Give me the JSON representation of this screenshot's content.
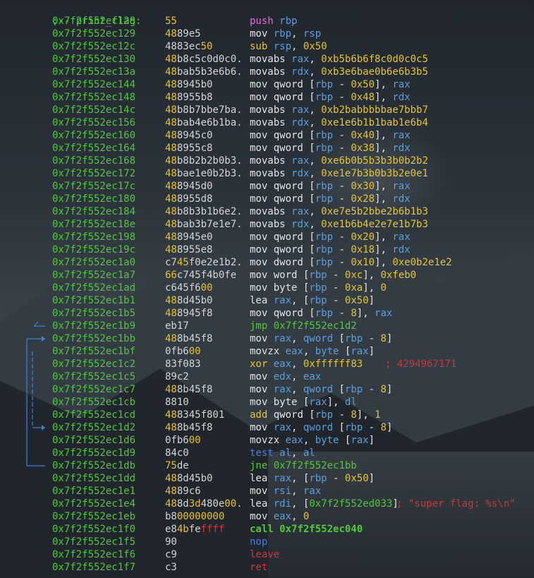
{
  "header_label": ";-- print_flag:",
  "colors": {
    "address": "#4fc93a",
    "register": "#5a9fe0",
    "immediate": "#e4c534",
    "comment": "#c33a3a",
    "jump_arrows": "#3b7fe0"
  },
  "rows": [
    {
      "addr": "0x7f2f552ec128",
      "bytes": [
        [
          "55",
          "hl"
        ]
      ],
      "ins": [
        [
          "push",
          "mn-push"
        ],
        [
          " "
        ],
        [
          "rbp",
          "reg"
        ]
      ]
    },
    {
      "addr": "0x7f2f552ec129",
      "bytes": [
        [
          "48",
          "hl"
        ],
        [
          "89e5"
        ]
      ],
      "ins": [
        [
          "mov "
        ],
        [
          "rbp",
          "reg"
        ],
        [
          ", "
        ],
        [
          "rsp",
          "reg"
        ]
      ]
    },
    {
      "addr": "0x7f2f552ec12c",
      "bytes": [
        [
          "4883ec"
        ],
        [
          "50",
          "hl"
        ]
      ],
      "ins": [
        [
          "sub",
          "mn-sub"
        ],
        [
          " "
        ],
        [
          "rsp",
          "reg"
        ],
        [
          ", "
        ],
        [
          "0x50",
          "num"
        ]
      ]
    },
    {
      "addr": "0x7f2f552ec130",
      "bytes": [
        [
          "48",
          "hl"
        ],
        [
          "b8c5c0d0c0."
        ]
      ],
      "ins": [
        [
          "movabs "
        ],
        [
          "rax",
          "reg"
        ],
        [
          ", "
        ],
        [
          "0xb5b6b6f8c0d0c0c5",
          "num"
        ]
      ]
    },
    {
      "addr": "0x7f2f552ec13a",
      "bytes": [
        [
          "48",
          "hl"
        ],
        [
          "bab5b3e6b6."
        ]
      ],
      "ins": [
        [
          "movabs "
        ],
        [
          "rdx",
          "reg"
        ],
        [
          ", "
        ],
        [
          "0xb3e6bae0b6e6b3b5",
          "num"
        ]
      ]
    },
    {
      "addr": "0x7f2f552ec144",
      "bytes": [
        [
          "48",
          "hl"
        ],
        [
          "8945b0"
        ]
      ],
      "ins": [
        [
          "mov qword ["
        ],
        [
          "rbp",
          "reg"
        ],
        [
          " - "
        ],
        [
          "0x50",
          "num"
        ],
        [
          "], "
        ],
        [
          "rax",
          "reg"
        ]
      ]
    },
    {
      "addr": "0x7f2f552ec148",
      "bytes": [
        [
          "48",
          "hl"
        ],
        [
          "8955b8"
        ]
      ],
      "ins": [
        [
          "mov qword ["
        ],
        [
          "rbp",
          "reg"
        ],
        [
          " - "
        ],
        [
          "0x48",
          "num"
        ],
        [
          "], "
        ],
        [
          "rdx",
          "reg"
        ]
      ]
    },
    {
      "addr": "0x7f2f552ec14c",
      "bytes": [
        [
          "48",
          "hl"
        ],
        [
          "b8b7bbe7ba."
        ]
      ],
      "ins": [
        [
          "movabs "
        ],
        [
          "rax",
          "reg"
        ],
        [
          ", "
        ],
        [
          "0xb2babbbbbae7bbb7",
          "num"
        ]
      ]
    },
    {
      "addr": "0x7f2f552ec156",
      "bytes": [
        [
          "48",
          "hl"
        ],
        [
          "bab4e6b1ba."
        ]
      ],
      "ins": [
        [
          "movabs "
        ],
        [
          "rdx",
          "reg"
        ],
        [
          ", "
        ],
        [
          "0xe1e6b1b1bab1e6b4",
          "num"
        ]
      ]
    },
    {
      "addr": "0x7f2f552ec160",
      "bytes": [
        [
          "48",
          "hl"
        ],
        [
          "8945c0"
        ]
      ],
      "ins": [
        [
          "mov qword ["
        ],
        [
          "rbp",
          "reg"
        ],
        [
          " - "
        ],
        [
          "0x40",
          "num"
        ],
        [
          "], "
        ],
        [
          "rax",
          "reg"
        ]
      ]
    },
    {
      "addr": "0x7f2f552ec164",
      "bytes": [
        [
          "48",
          "hl"
        ],
        [
          "8955c8"
        ]
      ],
      "ins": [
        [
          "mov qword ["
        ],
        [
          "rbp",
          "reg"
        ],
        [
          " - "
        ],
        [
          "0x38",
          "num"
        ],
        [
          "], "
        ],
        [
          "rdx",
          "reg"
        ]
      ]
    },
    {
      "addr": "0x7f2f552ec168",
      "bytes": [
        [
          "48",
          "hl"
        ],
        [
          "b8b2b2b0b3."
        ]
      ],
      "ins": [
        [
          "movabs "
        ],
        [
          "rax",
          "reg"
        ],
        [
          ", "
        ],
        [
          "0xe6b0b5b3b3b0b2b2",
          "num"
        ]
      ]
    },
    {
      "addr": "0x7f2f552ec172",
      "bytes": [
        [
          "48",
          "hl"
        ],
        [
          "bae1e0b2b3."
        ]
      ],
      "ins": [
        [
          "movabs "
        ],
        [
          "rdx",
          "reg"
        ],
        [
          ", "
        ],
        [
          "0xe1e7b3b0b3b2e0e1",
          "num"
        ]
      ]
    },
    {
      "addr": "0x7f2f552ec17c",
      "bytes": [
        [
          "48",
          "hl"
        ],
        [
          "8945d0"
        ]
      ],
      "ins": [
        [
          "mov qword ["
        ],
        [
          "rbp",
          "reg"
        ],
        [
          " - "
        ],
        [
          "0x30",
          "num"
        ],
        [
          "], "
        ],
        [
          "rax",
          "reg"
        ]
      ]
    },
    {
      "addr": "0x7f2f552ec180",
      "bytes": [
        [
          "48",
          "hl"
        ],
        [
          "8955d8"
        ]
      ],
      "ins": [
        [
          "mov qword ["
        ],
        [
          "rbp",
          "reg"
        ],
        [
          " - "
        ],
        [
          "0x28",
          "num"
        ],
        [
          "], "
        ],
        [
          "rdx",
          "reg"
        ]
      ]
    },
    {
      "addr": "0x7f2f552ec184",
      "bytes": [
        [
          "48",
          "hl"
        ],
        [
          "b8b3b1b6e2."
        ]
      ],
      "ins": [
        [
          "movabs "
        ],
        [
          "rax",
          "reg"
        ],
        [
          ", "
        ],
        [
          "0xe7e5b2bbe2b6b1b3",
          "num"
        ]
      ]
    },
    {
      "addr": "0x7f2f552ec18e",
      "bytes": [
        [
          "48",
          "hl"
        ],
        [
          "bab3b7e1e7."
        ]
      ],
      "ins": [
        [
          "movabs "
        ],
        [
          "rdx",
          "reg"
        ],
        [
          ", "
        ],
        [
          "0xe1b6b4e2e7e1b7b3",
          "num"
        ]
      ]
    },
    {
      "addr": "0x7f2f552ec198",
      "bytes": [
        [
          "48",
          "hl"
        ],
        [
          "8945e0"
        ]
      ],
      "ins": [
        [
          "mov qword ["
        ],
        [
          "rbp",
          "reg"
        ],
        [
          " - "
        ],
        [
          "0x20",
          "num"
        ],
        [
          "], "
        ],
        [
          "rax",
          "reg"
        ]
      ]
    },
    {
      "addr": "0x7f2f552ec19c",
      "bytes": [
        [
          "48",
          "hl"
        ],
        [
          "8955e8"
        ]
      ],
      "ins": [
        [
          "mov qword ["
        ],
        [
          "rbp",
          "reg"
        ],
        [
          " - "
        ],
        [
          "0x18",
          "num"
        ],
        [
          "], "
        ],
        [
          "rdx",
          "reg"
        ]
      ]
    },
    {
      "addr": "0x7f2f552ec1a0",
      "bytes": [
        [
          "c7"
        ],
        [
          "45",
          "hl"
        ],
        [
          "f0e2e1b2."
        ]
      ],
      "ins": [
        [
          "mov dword ["
        ],
        [
          "rbp",
          "reg"
        ],
        [
          " - "
        ],
        [
          "0x10",
          "num"
        ],
        [
          "], "
        ],
        [
          "0xe0b2e1e2",
          "num"
        ]
      ]
    },
    {
      "addr": "0x7f2f552ec1a7",
      "bytes": [
        [
          "66",
          "hl"
        ],
        [
          "c745f4b0fe"
        ]
      ],
      "ins": [
        [
          "mov word ["
        ],
        [
          "rbp",
          "reg"
        ],
        [
          " - "
        ],
        [
          "0xc",
          "num"
        ],
        [
          "], "
        ],
        [
          "0xfeb0",
          "num"
        ]
      ]
    },
    {
      "addr": "0x7f2f552ec1ad",
      "bytes": [
        [
          "c645f6"
        ],
        [
          "00",
          "hl"
        ]
      ],
      "ins": [
        [
          "mov byte ["
        ],
        [
          "rbp",
          "reg"
        ],
        [
          " - "
        ],
        [
          "0xa",
          "num"
        ],
        [
          "], "
        ],
        [
          "0",
          "num"
        ]
      ]
    },
    {
      "addr": "0x7f2f552ec1b1",
      "bytes": [
        [
          "48",
          "hl"
        ],
        [
          "8d45b0"
        ]
      ],
      "ins": [
        [
          "lea "
        ],
        [
          "rax",
          "reg"
        ],
        [
          ", ["
        ],
        [
          "rbp",
          "reg"
        ],
        [
          " - "
        ],
        [
          "0x50",
          "num"
        ],
        [
          "]"
        ]
      ]
    },
    {
      "addr": "0x7f2f552ec1b5",
      "bytes": [
        [
          "48",
          "hl"
        ],
        [
          "8945f8"
        ]
      ],
      "ins": [
        [
          "mov qword ["
        ],
        [
          "rbp",
          "reg"
        ],
        [
          " - "
        ],
        [
          "8",
          "num"
        ],
        [
          "], "
        ],
        [
          "rax",
          "reg"
        ]
      ]
    },
    {
      "addr": "0x7f2f552ec1b9",
      "bytes": [
        [
          "eb17"
        ]
      ],
      "ins": [
        [
          "jmp",
          "mn-jmp"
        ],
        [
          " "
        ],
        [
          "0x7f2f552ec1d2",
          "addrref"
        ]
      ]
    },
    {
      "addr": "0x7f2f552ec1bb",
      "bytes": [
        [
          "48",
          "hl"
        ],
        [
          "8b45f8"
        ]
      ],
      "ins": [
        [
          "mov "
        ],
        [
          "rax",
          "reg"
        ],
        [
          ", "
        ],
        [
          "qword",
          "reg"
        ],
        [
          " ["
        ],
        [
          "rbp",
          "reg"
        ],
        [
          " - "
        ],
        [
          "8",
          "num"
        ],
        [
          "]"
        ]
      ]
    },
    {
      "addr": "0x7f2f552ec1bf",
      "bytes": [
        [
          "0fb6"
        ],
        [
          "00",
          "hl"
        ]
      ],
      "ins": [
        [
          "movzx "
        ],
        [
          "eax",
          "reg"
        ],
        [
          ", "
        ],
        [
          "byte",
          "reg"
        ],
        [
          " ["
        ],
        [
          "rax",
          "reg"
        ],
        [
          "]"
        ]
      ]
    },
    {
      "addr": "0x7f2f552ec1c2",
      "bytes": [
        [
          "83f083"
        ]
      ],
      "ins": [
        [
          "xor",
          "mn-xor"
        ],
        [
          " "
        ],
        [
          "eax",
          "reg"
        ],
        [
          ", "
        ],
        [
          "0xffffff83",
          "num"
        ]
      ],
      "comment": [
        "; 4294967171",
        "c1"
      ]
    },
    {
      "addr": "0x7f2f552ec1c5",
      "bytes": [
        [
          "89c2"
        ]
      ],
      "ins": [
        [
          "mov "
        ],
        [
          "edx",
          "reg"
        ],
        [
          ", "
        ],
        [
          "eax",
          "reg"
        ]
      ]
    },
    {
      "addr": "0x7f2f552ec1c7",
      "bytes": [
        [
          "48",
          "hl"
        ],
        [
          "8b45f8"
        ]
      ],
      "ins": [
        [
          "mov "
        ],
        [
          "rax",
          "reg"
        ],
        [
          ", "
        ],
        [
          "qword",
          "reg"
        ],
        [
          " ["
        ],
        [
          "rbp",
          "reg"
        ],
        [
          " - "
        ],
        [
          "8",
          "num"
        ],
        [
          "]"
        ]
      ]
    },
    {
      "addr": "0x7f2f552ec1cb",
      "bytes": [
        [
          "8810"
        ]
      ],
      "ins": [
        [
          "mov byte ["
        ],
        [
          "rax",
          "reg"
        ],
        [
          "], "
        ],
        [
          "dl",
          "reg"
        ]
      ]
    },
    {
      "addr": "0x7f2f552ec1cd",
      "bytes": [
        [
          "48",
          "hl"
        ],
        [
          "8345f801"
        ]
      ],
      "ins": [
        [
          "add",
          "mn-add"
        ],
        [
          " qword ["
        ],
        [
          "rbp",
          "reg"
        ],
        [
          " - "
        ],
        [
          "8",
          "num"
        ],
        [
          "], "
        ],
        [
          "1",
          "num"
        ]
      ]
    },
    {
      "addr": "0x7f2f552ec1d2",
      "bytes": [
        [
          "48",
          "hl"
        ],
        [
          "8b45f8"
        ]
      ],
      "ins": [
        [
          "mov "
        ],
        [
          "rax",
          "reg"
        ],
        [
          ", "
        ],
        [
          "qword",
          "reg"
        ],
        [
          " ["
        ],
        [
          "rbp",
          "reg"
        ],
        [
          " - "
        ],
        [
          "8",
          "num"
        ],
        [
          "]"
        ]
      ]
    },
    {
      "addr": "0x7f2f552ec1d6",
      "bytes": [
        [
          "0fb6"
        ],
        [
          "00",
          "hl"
        ]
      ],
      "ins": [
        [
          "movzx "
        ],
        [
          "eax",
          "reg"
        ],
        [
          ", "
        ],
        [
          "byte",
          "reg"
        ],
        [
          " ["
        ],
        [
          "rax",
          "reg"
        ],
        [
          "]"
        ]
      ]
    },
    {
      "addr": "0x7f2f552ec1d9",
      "bytes": [
        [
          "84c0"
        ]
      ],
      "ins": [
        [
          "test",
          "mn-test"
        ],
        [
          " "
        ],
        [
          "al",
          "reg"
        ],
        [
          ", "
        ],
        [
          "al",
          "reg"
        ]
      ]
    },
    {
      "addr": "0x7f2f552ec1db",
      "bytes": [
        [
          "75",
          "hl"
        ],
        [
          "de"
        ]
      ],
      "ins": [
        [
          "jne",
          "mn-jne"
        ],
        [
          " "
        ],
        [
          "0x7f2f552ec1bb",
          "addrref"
        ]
      ]
    },
    {
      "addr": "0x7f2f552ec1dd",
      "bytes": [
        [
          "48",
          "hl"
        ],
        [
          "8d45b0"
        ]
      ],
      "ins": [
        [
          "lea "
        ],
        [
          "rax",
          "reg"
        ],
        [
          ", ["
        ],
        [
          "rbp",
          "reg"
        ],
        [
          " - "
        ],
        [
          "0x50",
          "num"
        ],
        [
          "]"
        ]
      ]
    },
    {
      "addr": "0x7f2f552ec1e1",
      "bytes": [
        [
          "48",
          "hl"
        ],
        [
          "89c6"
        ]
      ],
      "ins": [
        [
          "mov "
        ],
        [
          "rsi",
          "reg"
        ],
        [
          ", "
        ],
        [
          "rax",
          "reg"
        ]
      ]
    },
    {
      "addr": "0x7f2f552ec1e4",
      "bytes": [
        [
          "48",
          "hl"
        ],
        [
          "8d"
        ],
        [
          "3d",
          "hl"
        ],
        [
          "480e"
        ],
        [
          "00",
          "hl"
        ],
        [
          "."
        ]
      ],
      "ins": [
        [
          "lea "
        ],
        [
          "rdi",
          "reg"
        ],
        [
          ", ["
        ],
        [
          "0x7f2f552ed033",
          "addrref"
        ],
        [
          "]"
        ]
      ],
      "comment": [
        "; \"super flag: %s\\n\"",
        "c2"
      ]
    },
    {
      "addr": "0x7f2f552ec1eb",
      "bytes": [
        [
          "b8"
        ],
        [
          "00000000",
          "hl"
        ]
      ],
      "ins": [
        [
          "mov "
        ],
        [
          "eax",
          "reg"
        ],
        [
          ", "
        ],
        [
          "0",
          "num"
        ]
      ]
    },
    {
      "addr": "0x7f2f552ec1f0",
      "bytes": [
        [
          "e8"
        ],
        [
          "4b",
          "hl"
        ],
        [
          "fe"
        ],
        [
          "ffff",
          "red"
        ]
      ],
      "ins": [
        [
          "call",
          "mn-call"
        ],
        [
          " "
        ],
        [
          "0x7f2f552ec040",
          "callref"
        ]
      ]
    },
    {
      "addr": "0x7f2f552ec1f5",
      "bytes": [
        [
          "90"
        ]
      ],
      "ins": [
        [
          "nop",
          "mn-nop"
        ]
      ]
    },
    {
      "addr": "0x7f2f552ec1f6",
      "bytes": [
        [
          "c9"
        ]
      ],
      "ins": [
        [
          "leave",
          "mn-leave"
        ]
      ]
    },
    {
      "addr": "0x7f2f552ec1f7",
      "bytes": [
        [
          "c3"
        ]
      ],
      "ins": [
        [
          "ret",
          "mn-ret"
        ]
      ]
    }
  ]
}
